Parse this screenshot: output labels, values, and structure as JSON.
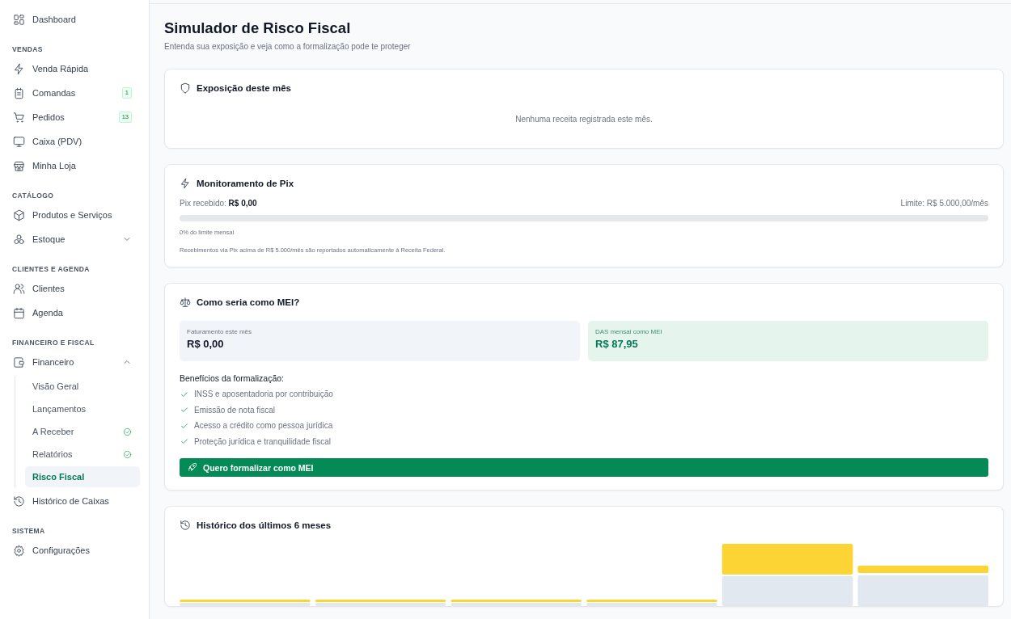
{
  "sidebar": {
    "sections": [
      {
        "items": [
          {
            "label": "Dashboard",
            "selected": false
          }
        ]
      },
      {
        "title": "VENDAS",
        "items": [
          {
            "label": "Venda Rápida",
            "selected": false
          },
          {
            "label": "Comandas",
            "badge": "1",
            "selected": false
          },
          {
            "label": "Pedidos",
            "badge": "13",
            "selected": false
          },
          {
            "label": "Caixa (PDV)",
            "selected": false
          },
          {
            "label": "Minha Loja",
            "selected": false
          }
        ]
      },
      {
        "title": "CATÁLOGO",
        "items": [
          {
            "label": "Produtos e Serviços",
            "selected": false
          },
          {
            "label": "Estoque",
            "selected": false,
            "expanded": false
          }
        ]
      },
      {
        "title": "CLIENTES E AGENDA",
        "items": [
          {
            "label": "Clientes",
            "selected": false
          },
          {
            "label": "Agenda",
            "selected": false
          }
        ]
      },
      {
        "title": "FINANCEIRO E FISCAL",
        "items": [
          {
            "label": "Financeiro",
            "selected": false,
            "expanded": true,
            "children": [
              {
                "label": "Visão Geral",
                "selected": false,
                "verified": false
              },
              {
                "label": "Lançamentos",
                "selected": false,
                "verified": false
              },
              {
                "label": "A Receber",
                "selected": false,
                "verified": true
              },
              {
                "label": "Relatórios",
                "selected": false,
                "verified": true
              },
              {
                "label": "Risco Fiscal",
                "selected": true,
                "verified": false
              }
            ]
          },
          {
            "label": "Histórico de Caixas",
            "selected": false
          }
        ]
      },
      {
        "title": "SISTEMA",
        "items": [
          {
            "label": "Configurações",
            "selected": false
          }
        ]
      }
    ]
  },
  "page": {
    "title": "Simulador de Risco Fiscal",
    "subtitle": "Entenda sua exposição e veja como a formalização pode te proteger"
  },
  "exposure": {
    "title": "Exposição deste mês",
    "empty_message": "Nenhuma receita registrada este mês."
  },
  "pix": {
    "title": "Monitoramento de Pix",
    "received": "Pix recebido: **R$ 0,00**",
    "limit": "Limite: R$ 5.000,00/mês",
    "level": 0,
    "percent_text": "0% do limite mensal",
    "note": "Recebimentos via Pix acima de R$ 5.000/mês são reportados automaticamente à Receita Federal."
  },
  "mei": {
    "title": "Como seria como MEI?",
    "stats": [
      {
        "label": "Faturamento este mês",
        "value": "R$ 0,00",
        "kind": "neutral"
      },
      {
        "label": "DAS mensal como MEI",
        "value": "R$ 87,95",
        "kind": "highlight"
      }
    ],
    "benefits_title": "Benefícios da formalização:",
    "benefits": [
      "INSS e aposentadoria por contribuição",
      "Emissão de nota fiscal",
      "Acesso a crédito como pessoa jurídica",
      "Proteção jurídica e tranquilidade fiscal"
    ],
    "button": "Quero formalizar como MEI"
  },
  "history": {
    "title": "Histórico dos últimos 6 meses"
  }
}
